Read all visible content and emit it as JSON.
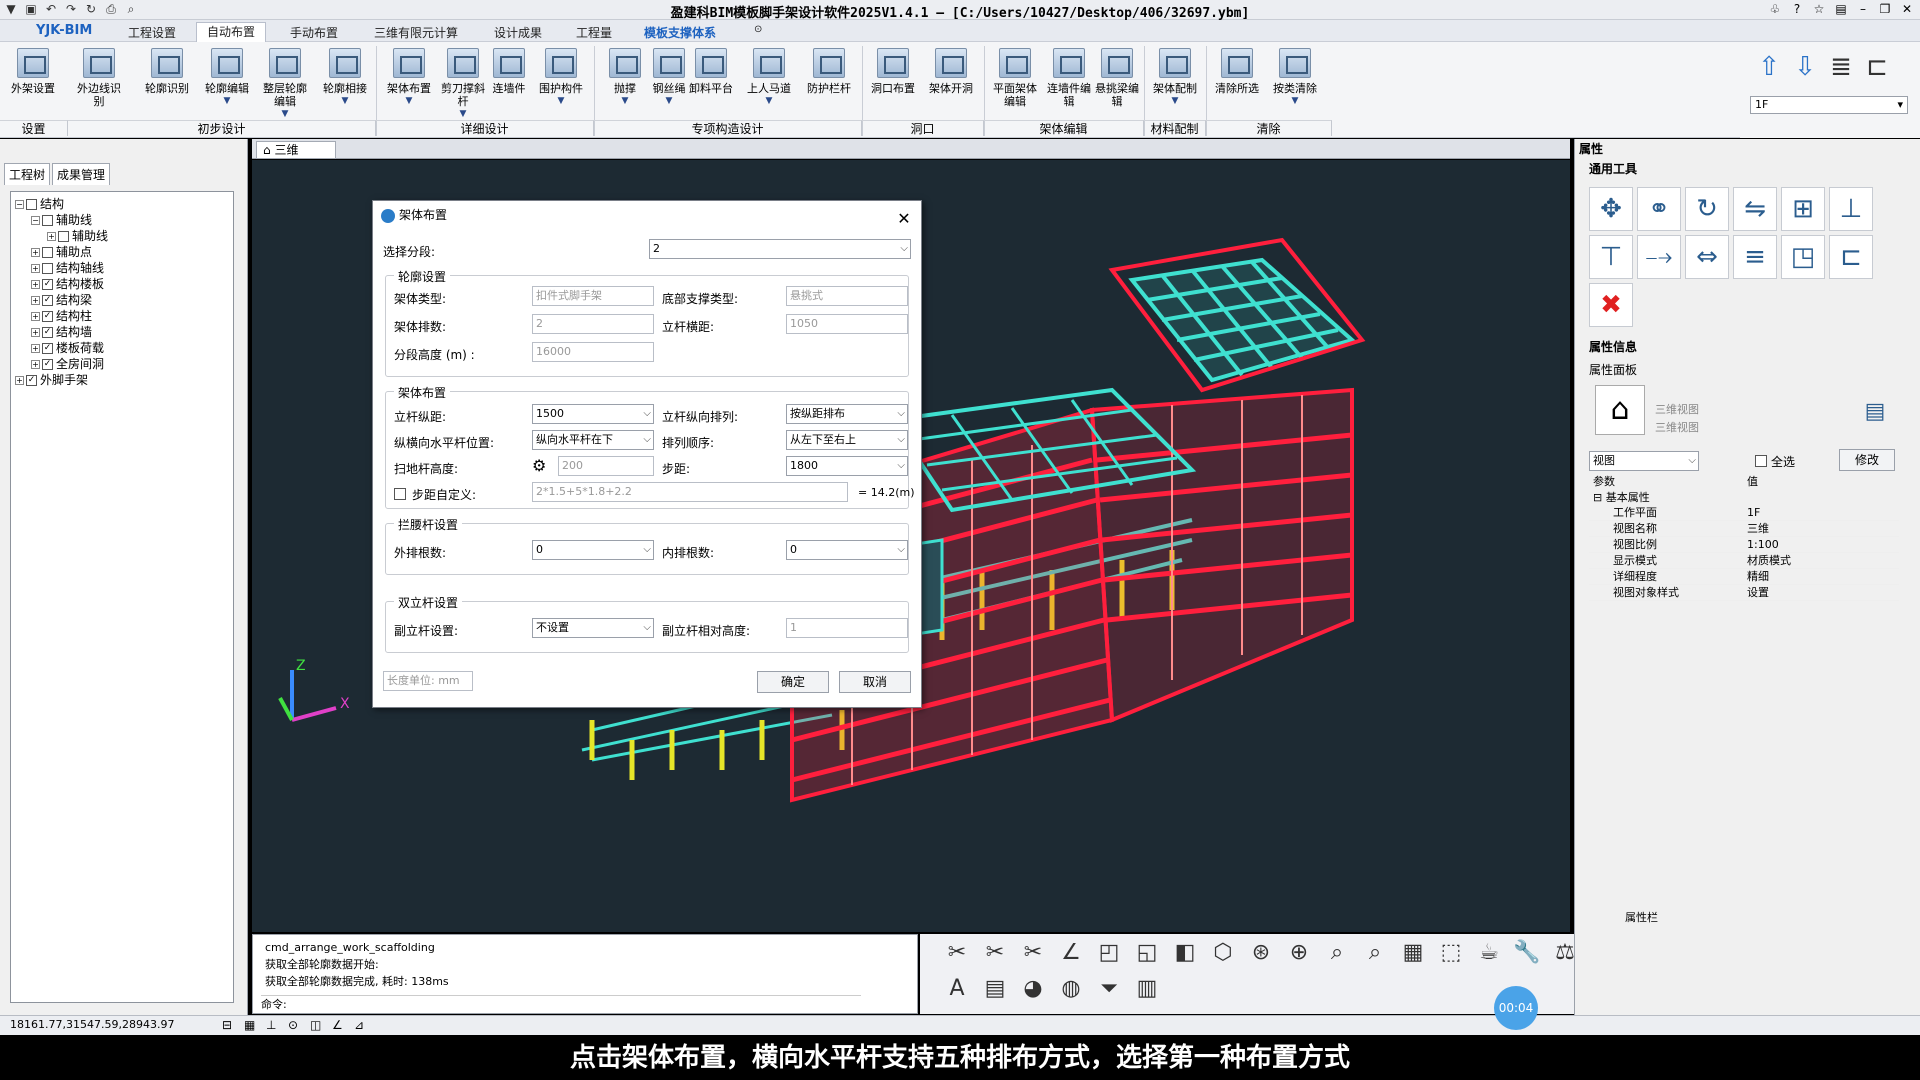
{
  "titlebar": {
    "title": "盈建科BIM模板脚手架设计软件2025V1.4.1 — [C:/Users/10427/Desktop/406/32697.ybm]"
  },
  "menubar": {
    "brand": "YJK-BIM",
    "tabs": [
      "工程设置",
      "自动布置",
      "手动布置",
      "三维有限元计算",
      "设计成果",
      "工程量",
      "模板支撑体系"
    ]
  },
  "ribbon": {
    "buttons": [
      "外架设置",
      "外边线识别",
      "轮廓识别",
      "轮廓编辑",
      "整层轮廓编辑",
      "轮廓相接",
      "架体布置",
      "剪刀撑斜杆",
      "连墙件",
      "围护构件",
      "抛撑",
      "钢丝绳",
      "卸料平台",
      "上人马道",
      "防护栏杆",
      "洞口布置",
      "架体开洞",
      "平面架体编辑",
      "连墙件编辑",
      "悬挑梁编辑",
      "架体配制",
      "清除所选",
      "按类清除"
    ],
    "groups": [
      "设置",
      "初步设计",
      "详细设计",
      "专项构造设计",
      "洞口",
      "架体编辑",
      "材料配制",
      "清除"
    ],
    "floor": "1F"
  },
  "leftpanel": {
    "tabs": [
      "工程树",
      "成果管理"
    ],
    "tree": [
      {
        "label": "结构",
        "level": 0,
        "checked": false,
        "expander": "−"
      },
      {
        "label": "辅助线",
        "level": 1,
        "checked": false,
        "expander": "−"
      },
      {
        "label": "辅助线",
        "level": 2,
        "checked": false,
        "expander": "+"
      },
      {
        "label": "辅助点",
        "level": 1,
        "checked": false,
        "expander": "+"
      },
      {
        "label": "结构轴线",
        "level": 1,
        "checked": false,
        "expander": "+"
      },
      {
        "label": "结构楼板",
        "level": 1,
        "checked": true,
        "expander": "+"
      },
      {
        "label": "结构梁",
        "level": 1,
        "checked": true,
        "expander": "+"
      },
      {
        "label": "结构柱",
        "level": 1,
        "checked": true,
        "expander": "+"
      },
      {
        "label": "结构墙",
        "level": 1,
        "checked": true,
        "expander": "+"
      },
      {
        "label": "楼板荷载",
        "level": 1,
        "checked": true,
        "expander": "+"
      },
      {
        "label": "全房间洞",
        "level": 1,
        "checked": true,
        "expander": "+"
      },
      {
        "label": "外脚手架",
        "level": 0,
        "checked": true,
        "expander": "+"
      }
    ]
  },
  "viewtab": {
    "label": "三维"
  },
  "dialog": {
    "title": "架体布置",
    "segment_label": "选择分段:",
    "segment_value": "2",
    "outline": {
      "legend": "轮廓设置",
      "frame_type_label": "架体类型:",
      "frame_type": "扣件式脚手架",
      "bottom_support_label": "底部支撑类型:",
      "bottom_support": "悬挑式",
      "rows_label": "架体排数:",
      "rows": "2",
      "pole_spacing_label": "立杆横距:",
      "pole_spacing": "1050",
      "seg_height_label": "分段高度 (m) :",
      "seg_height": "16000"
    },
    "layout": {
      "legend": "架体布置",
      "longitudinal_label": "立杆纵距:",
      "longitudinal": "1500",
      "arrange_label": "立杆纵向排列:",
      "arrange": "按纵距排布",
      "horizontal_pos_label": "纵横向水平杆位置:",
      "horizontal_pos": "纵向水平杆在下",
      "order_label": "排列顺序:",
      "order": "从左下至右上",
      "sweep_label": "扫地杆高度:",
      "sweep": "200",
      "step_label": "步距:",
      "step": "1800",
      "custom_label": "步距自定义:",
      "custom": "2*1.5+5*1.8+2.2",
      "custom_total": "= 14.2(m)"
    },
    "waist": {
      "legend": "拦腰杆设置",
      "outer_label": "外排根数:",
      "outer": "0",
      "inner_label": "内排根数:",
      "inner": "0"
    },
    "double": {
      "legend": "双立杆设置",
      "set_label": "副立杆设置:",
      "set": "不设置",
      "height_label": "副立杆相对高度:",
      "height": "1"
    },
    "unit": "长度单位: mm",
    "ok": "确定",
    "cancel": "取消"
  },
  "cmd": {
    "lines": [
      "cmd_arrange_work_scaffolding",
      "获取全部轮廓数据开始:",
      "获取全部轮廓数据完成, 耗时: 138ms"
    ],
    "prompt": "命令:"
  },
  "rightpanel": {
    "header": "属性",
    "tools_header": "通用工具",
    "info_header": "属性信息",
    "panel_label": "属性面板",
    "view_names": [
      "三维视图",
      "三维视图"
    ],
    "view_select": "视图",
    "select_all": "全选",
    "modify": "修改",
    "col_param": "参数",
    "col_value": "值",
    "group": "基本属性",
    "props": [
      {
        "k": "工作平面",
        "v": "1F"
      },
      {
        "k": "视图名称",
        "v": "三维"
      },
      {
        "k": "视图比例",
        "v": "1:100"
      },
      {
        "k": "显示模式",
        "v": "材质模式"
      },
      {
        "k": "详细程度",
        "v": "精细"
      },
      {
        "k": "视图对象样式",
        "v": "设置"
      }
    ],
    "bottom_tab": "属性栏"
  },
  "statusbar": {
    "coords": "18161.77,31547.59,28943.97"
  },
  "timer": "00:04",
  "subtitle": "点击架体布置，横向水平杆支持五种排布方式，选择第一种布置方式",
  "colors": {
    "frame_red": "#ff1f3d",
    "slab_cyan": "#3fe0d0",
    "column_yellow": "#e6e628",
    "accent_blue": "#1d62c0"
  }
}
